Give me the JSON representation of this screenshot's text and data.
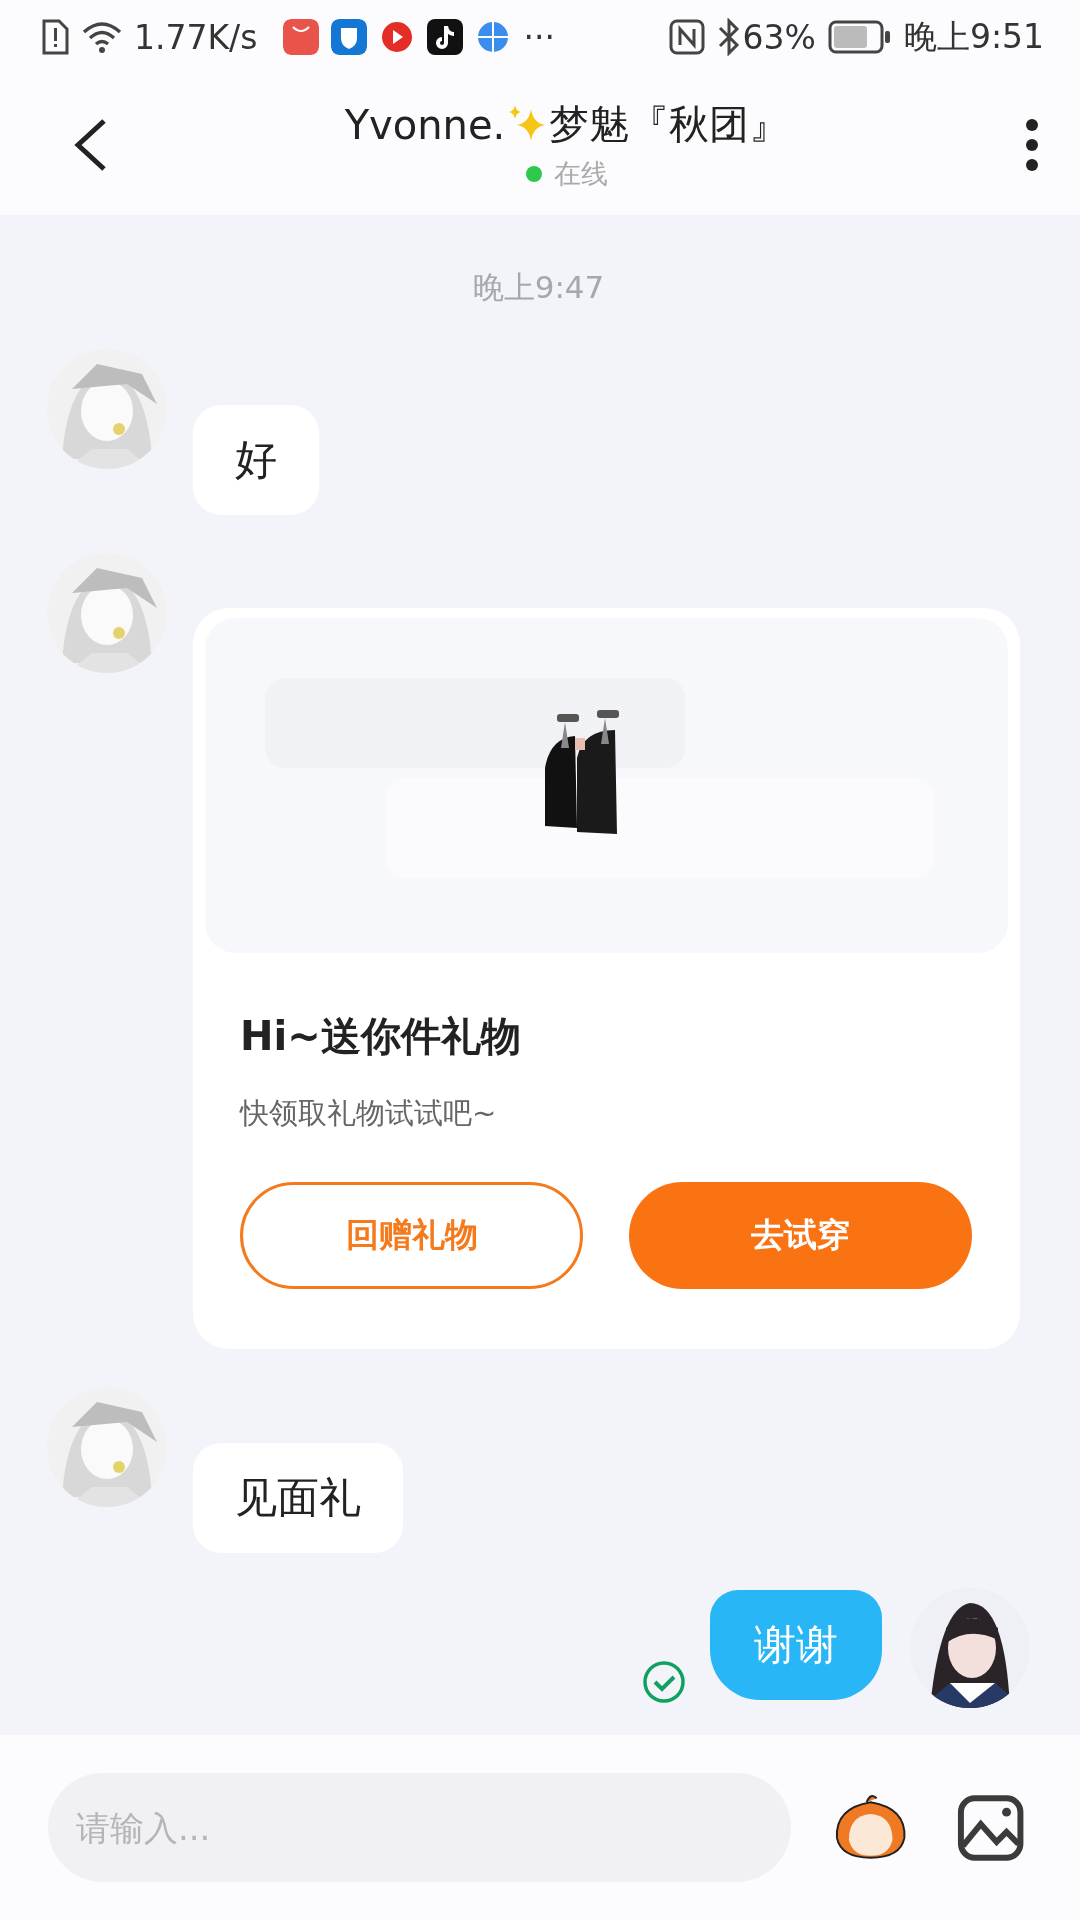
{
  "status_bar": {
    "net_speed": "1.77K/s",
    "more": "···",
    "battery": "63%",
    "time": "晚上9:51"
  },
  "header": {
    "name": "Yvonne.",
    "title_rest": "梦魅『秋团』",
    "presence": "在线",
    "online": true
  },
  "timestamp": "晚上9:47",
  "messages": [
    {
      "kind": "received",
      "text": "好"
    },
    {
      "kind": "gift",
      "title": "Hi~送你件礼物",
      "subtitle": "快领取礼物试试吧~",
      "buttons": [
        {
          "label": "回赠礼物"
        },
        {
          "label": "去试穿"
        }
      ]
    },
    {
      "kind": "received",
      "text": "见面礼"
    },
    {
      "kind": "sent",
      "text": "谢谢",
      "read": true
    }
  ],
  "composer": {
    "placeholder": "请输入..."
  }
}
